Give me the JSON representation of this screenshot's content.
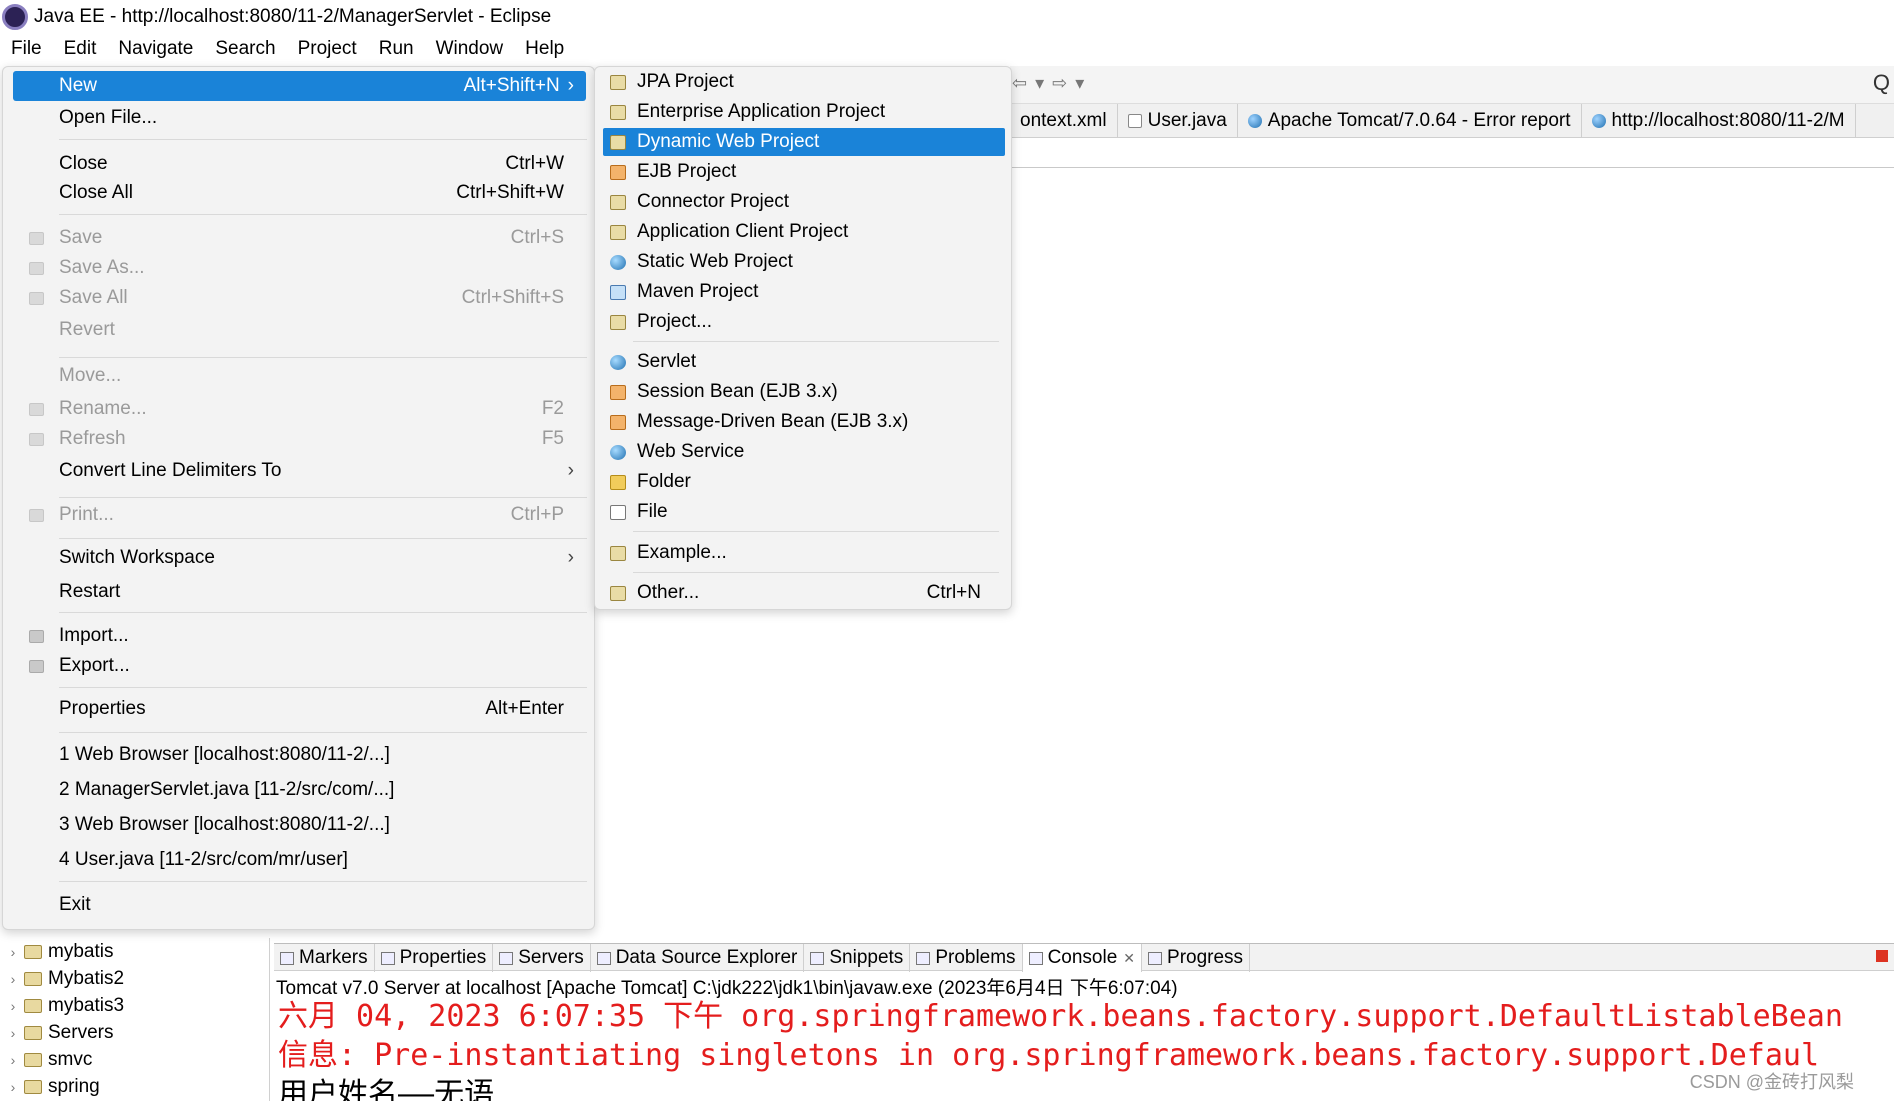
{
  "window": {
    "title": "Java EE - http://localhost:8080/11-2/ManagerServlet - Eclipse"
  },
  "menubar": [
    "File",
    "Edit",
    "Navigate",
    "Search",
    "Project",
    "Run",
    "Window",
    "Help"
  ],
  "file_menu": {
    "items": [
      {
        "label": "New",
        "accel": "Alt+Shift+N",
        "submenu": true,
        "highlight": true
      },
      {
        "label": "Open File..."
      },
      {
        "label": "Close",
        "accel": "Ctrl+W"
      },
      {
        "label": "Close All",
        "accel": "Ctrl+Shift+W"
      },
      {
        "label": "Save",
        "accel": "Ctrl+S",
        "disabled": true
      },
      {
        "label": "Save As...",
        "disabled": true
      },
      {
        "label": "Save All",
        "accel": "Ctrl+Shift+S",
        "disabled": true
      },
      {
        "label": "Revert",
        "disabled": true
      },
      {
        "label": "Move...",
        "disabled": true
      },
      {
        "label": "Rename...",
        "accel": "F2",
        "disabled": true
      },
      {
        "label": "Refresh",
        "accel": "F5",
        "disabled": true
      },
      {
        "label": "Convert Line Delimiters To",
        "submenu": true
      },
      {
        "label": "Print...",
        "accel": "Ctrl+P",
        "disabled": true
      },
      {
        "label": "Switch Workspace",
        "submenu": true
      },
      {
        "label": "Restart"
      },
      {
        "label": "Import..."
      },
      {
        "label": "Export..."
      },
      {
        "label": "Properties",
        "accel": "Alt+Enter"
      },
      {
        "label": "1 Web Browser  [localhost:8080/11-2/...]"
      },
      {
        "label": "2 ManagerServlet.java  [11-2/src/com/...]"
      },
      {
        "label": "3 Web Browser  [localhost:8080/11-2/...]"
      },
      {
        "label": "4 User.java  [11-2/src/com/mr/user]"
      },
      {
        "label": "Exit"
      }
    ]
  },
  "new_menu": {
    "items": [
      {
        "label": "JPA Project"
      },
      {
        "label": "Enterprise Application Project"
      },
      {
        "label": "Dynamic Web Project",
        "highlight": true
      },
      {
        "label": "EJB Project"
      },
      {
        "label": "Connector Project"
      },
      {
        "label": "Application Client Project"
      },
      {
        "label": "Static Web Project"
      },
      {
        "label": "Maven Project"
      },
      {
        "label": "Project..."
      },
      {
        "label": "Servlet"
      },
      {
        "label": "Session Bean (EJB 3.x)"
      },
      {
        "label": "Message-Driven Bean (EJB 3.x)"
      },
      {
        "label": "Web Service"
      },
      {
        "label": "Folder"
      },
      {
        "label": "File"
      },
      {
        "label": "Example..."
      },
      {
        "label": "Other...",
        "accel": "Ctrl+N"
      }
    ]
  },
  "editor_tabs": [
    "ontext.xml",
    "User.java",
    "Apache Tomcat/7.0.64 - Error report",
    "http://localhost:8080/11-2/M"
  ],
  "project_tree": [
    "mybatis",
    "Mybatis2",
    "mybatis3",
    "Servers",
    "smvc",
    "spring"
  ],
  "view_tabs": [
    "Markers",
    "Properties",
    "Servers",
    "Data Source Explorer",
    "Snippets",
    "Problems",
    "Console",
    "Progress"
  ],
  "console": {
    "header": "Tomcat v7.0 Server at localhost [Apache Tomcat] C:\\jdk222\\jdk1\\bin\\javaw.exe (2023年6月4日 下午6:07:04)",
    "lines": [
      "六月 04, 2023 6:07:35 下午 org.springframework.beans.factory.support.DefaultListableBean",
      "信息: Pre-instantiating singletons in org.springframework.beans.factory.support.Defaul",
      "用户姓名——无语"
    ]
  },
  "watermark": "CSDN @金砖打风梨"
}
